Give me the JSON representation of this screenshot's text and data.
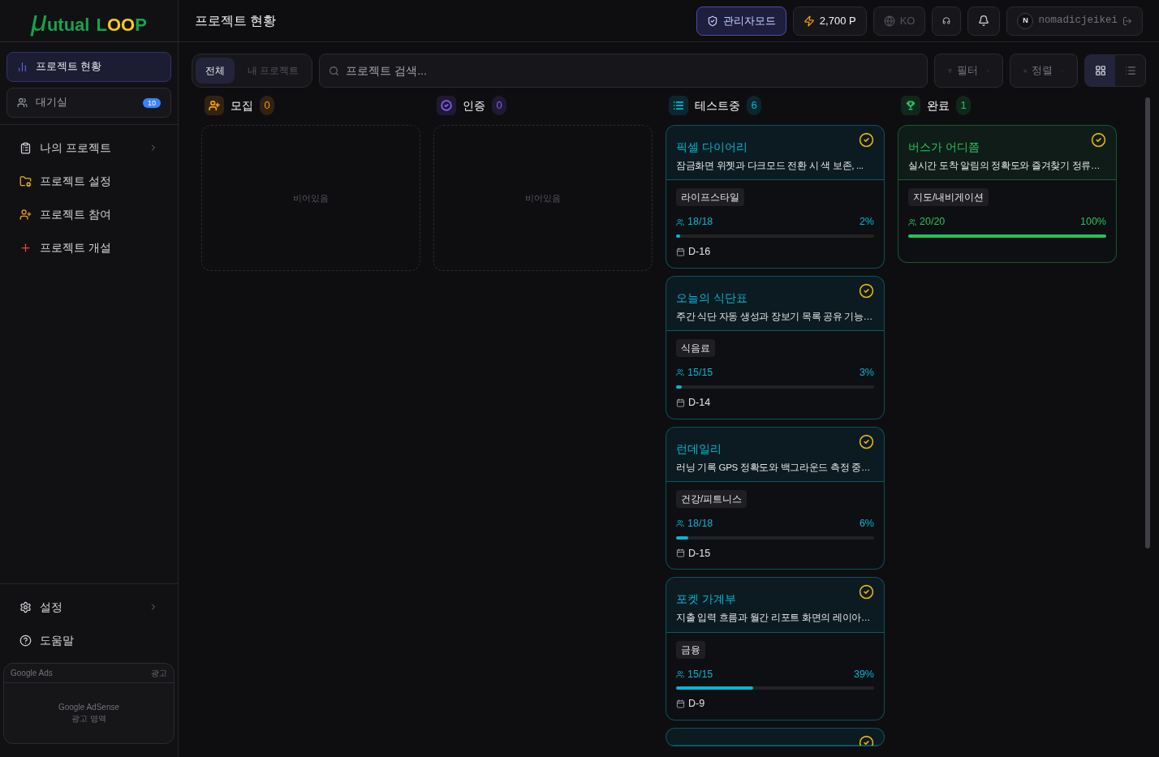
{
  "logo": [
    [
      {
        "text": "μ",
        "color": "#16a34a"
      },
      {
        "text": "utual",
        "color": "#16a34a"
      }
    ],
    [
      {
        "text": "L",
        "color": "#16a34a"
      },
      {
        "text": "OO",
        "color": "#facc15"
      },
      {
        "text": "P",
        "color": "#16a34a"
      }
    ]
  ],
  "sidebar": {
    "primary": [
      {
        "kind": "chart",
        "label": "프로젝트 현황",
        "selected": true
      },
      {
        "kind": "users",
        "label": "대기실",
        "badge": "10",
        "selected": false
      }
    ],
    "nav": [
      {
        "kind": "clipboard",
        "label": "나의 프로젝트",
        "expandable": true
      },
      {
        "kind": "settings-folder",
        "label": "프로젝트 설정",
        "expandable": false
      },
      {
        "kind": "user-plus",
        "label": "프로젝트 참여",
        "expandable": false
      },
      {
        "kind": "plus",
        "label": "프로젝트 개설",
        "expandable": false
      }
    ],
    "footer": [
      {
        "kind": "gear",
        "label": "설정",
        "expandable": true
      },
      {
        "kind": "help",
        "label": "도움말",
        "expandable": false
      }
    ],
    "ad": {
      "title": "Google Ads",
      "tag": "광고",
      "line1": "Google AdSense",
      "line2": "광고 영역"
    }
  },
  "header": {
    "title": "프로젝트 현황",
    "admin": {
      "label": "관리자모드",
      "on": true
    },
    "points": "2,700 P",
    "language": "KO",
    "user": {
      "initial": "N",
      "name": "nomadicjeikei"
    }
  },
  "toolbar": {
    "tabs": [
      {
        "label": "전체",
        "selected": true
      },
      {
        "label": "내 프로젝트",
        "selected": false
      }
    ],
    "search": {
      "placeholder": "프로젝트 검색..."
    },
    "filter": "필터",
    "sort": "정렬",
    "views": [
      {
        "kind": "grid",
        "selected": true
      },
      {
        "kind": "list",
        "selected": false
      }
    ]
  },
  "columns": [
    {
      "kind": "recruit",
      "title": "모집",
      "count": "0",
      "color": "#f59e0b",
      "empty_text": "비어있음"
    },
    {
      "kind": "verify",
      "title": "인증",
      "count": "0",
      "color": "#8b5cf6",
      "empty_text": "비어있음"
    },
    {
      "kind": "testing",
      "title": "테스트중",
      "count": "6",
      "color": "#06b6d4",
      "cards": [
        {
          "title": "픽셀 다이어리",
          "description": "잠금화면 위젯과 다크모드 전환 시 색 보존, ...",
          "category": "라이프스타일",
          "participants": "18/18",
          "percent": "2%",
          "level": 0.02,
          "deadline": "D-16",
          "verified": true
        },
        {
          "title": "오늘의 식단표",
          "description": "주간 식단 자동 생성과 장보기 목록 공유 기능…",
          "category": "식음료",
          "participants": "15/15",
          "percent": "3%",
          "level": 0.03,
          "deadline": "D-14",
          "verified": true
        },
        {
          "title": "런데일리",
          "description": "러닝 기록 GPS 정확도와 백그라운드 측정 중…",
          "category": "건강/피트니스",
          "participants": "18/18",
          "percent": "6%",
          "level": 0.06,
          "deadline": "D-15",
          "verified": true
        },
        {
          "title": "포켓 가계부",
          "description": "지출 입력 흐름과 월간 리포트 화면의 레이아…",
          "category": "금융",
          "participants": "15/15",
          "percent": "39%",
          "level": 0.39,
          "deadline": "D-9",
          "verified": true
        },
        {
          "verified": true
        }
      ]
    },
    {
      "kind": "done",
      "title": "완료",
      "count": "1",
      "color": "#22c55e",
      "cards": [
        {
          "title": "버스가 어디쯤",
          "description": "실시간 도착 알림의 정확도와 즐겨찾기 정류…",
          "category": "지도/내비게이션",
          "participants": "20/20",
          "percent": "100%",
          "level": 1,
          "verified": true
        }
      ]
    }
  ]
}
